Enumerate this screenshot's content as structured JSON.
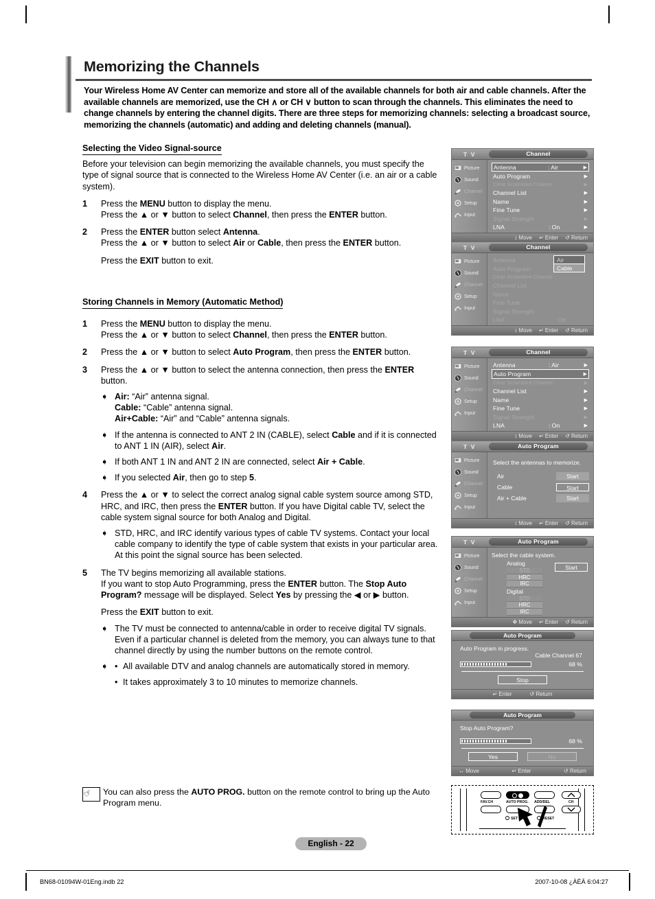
{
  "document": {
    "title": "Memorizing the Channels",
    "intro": "Your Wireless Home AV Center can memorize and store all of the available channels for both air and cable channels. After the available channels are memorized, use the CH ∧ or CH ∨ button to scan through the channels. This eliminates the need to change channels by entering the channel digits. There are three steps for memorizing channels: selecting a broadcast source, memorizing the channels (automatic) and adding and deleting channels (manual).",
    "page_badge": "English - 22",
    "footer_left": "BN68-01094W-01Eng.indb   22",
    "footer_right": "2007-10-08   ¿ÀÈÄ 6:04:27"
  },
  "section1": {
    "heading": "Selecting the Video Signal-source",
    "paragraph": "Before your television can begin memorizing the available channels, you must specify the type of signal source that is connected to the  Wireless Home AV Center (i.e. an air or a cable system).",
    "steps": [
      {
        "num": "1",
        "lines": [
          "Press the <b>MENU</b> button to display the menu.",
          "Press the ▲ or ▼ button to select <b>Channel</b>, then press the <b>ENTER</b> button."
        ]
      },
      {
        "num": "2",
        "lines": [
          "Press the <b>ENTER</b> button select <b>Antenna</b>.",
          "Press the ▲ or ▼ button to select <b>Air</b> or <b>Cable</b>, then press the <b>ENTER</b> button."
        ]
      }
    ],
    "exit_note": "Press the <b>EXIT</b> button to exit."
  },
  "section2": {
    "heading": "Storing Channels in Memory (Automatic Method)",
    "steps": [
      {
        "num": "1",
        "lines": [
          "Press the <b>MENU</b> button to display the menu.",
          "Press the ▲ or ▼ button to select <b>Channel</b>, then press the <b>ENTER</b> button."
        ]
      },
      {
        "num": "2",
        "lines": [
          "Press the ▲ or ▼ button to select <b>Auto Program</b>, then press the <b>ENTER</b> button."
        ]
      },
      {
        "num": "3",
        "lines": [
          "Press the ▲ or ▼ button to select the antenna connection, then press the <b>ENTER</b> button."
        ]
      }
    ],
    "bullets_after_3": [
      "<b>Air:</b> “Air” antenna signal.<br><b>Cable:</b> “Cable” antenna signal.<br><b>Air+Cable:</b> “Air” and “Cable” antenna signals.",
      "If the antenna is connected to ANT 2 IN (CABLE), select <b>Cable</b> and if it is connected to ANT 1 IN (AIR), select <b>Air</b>.",
      "If both ANT 1 IN and ANT 2 IN are connected, select <b>Air + Cable</b>.",
      "If you selected <b>Air</b>, then go to step <b>5</b>."
    ],
    "step4": {
      "num": "4",
      "text": "Press the ▲ or ▼ to select the correct analog signal cable system source among STD, HRC, and IRC, then press the <b>ENTER</b> button. If you have Digital cable TV, select the cable system signal source for both Analog and Digital."
    },
    "bullet_after_4": "STD, HRC, and IRC identify various types of cable TV systems. Contact your local cable company to identify the type of cable system that exists in your particular area. At this point the signal source has been selected.",
    "step5": {
      "num": "5",
      "text": "The TV begins memorizing all available stations.<br>If you want to stop Auto Programming, press the <b>ENTER</b> button. The <b>Stop Auto Program?</b> message will be displayed. Select <b>Yes</b> by pressing the ◀ or ▶ button."
    },
    "exit_note": "Press the <b>EXIT</b> button to exit.",
    "bullets_after_5": [
      "The TV must be connected to antenna/cable in order to receive digital TV signals. Even if a particular channel is deleted from the memory, you can always tune to that channel directly by using the number buttons on the remote control."
    ],
    "dot_bullets": [
      "All available DTV and analog channels are automatically stored in memory.",
      "It takes approximately 3 to 10 minutes to memorize channels."
    ]
  },
  "note": {
    "icon": "hand-pointer-icon",
    "text": "You can also press the <b>AUTO PROG.</b> button on the remote control to bring up the Auto Program menu."
  },
  "osd": {
    "tv_label": "T V",
    "sidebar": [
      {
        "label": "Picture",
        "icon": "picture-icon"
      },
      {
        "label": "Sound",
        "icon": "sound-icon"
      },
      {
        "label": "Channel",
        "icon": "channel-icon"
      },
      {
        "label": "Setup",
        "icon": "setup-icon"
      },
      {
        "label": "Input",
        "icon": "input-icon"
      }
    ],
    "footer": {
      "move": "Move",
      "enter": "Enter",
      "return": "Return"
    },
    "screen1": {
      "title": "Channel",
      "rows": [
        {
          "label": "Antenna",
          "value": ": Air",
          "state": "selected"
        },
        {
          "label": "Auto Program",
          "value": "",
          "state": "normal"
        },
        {
          "label": "Clear Scrambled Channel",
          "value": "",
          "state": "disabled"
        },
        {
          "label": "Channel List",
          "value": "",
          "state": "normal"
        },
        {
          "label": "Name",
          "value": "",
          "state": "normal"
        },
        {
          "label": "Fine Tune",
          "value": "",
          "state": "normal"
        },
        {
          "label": "Signal Strength",
          "value": "",
          "state": "disabled"
        },
        {
          "label": "LNA",
          "value": ": On",
          "state": "normal"
        }
      ]
    },
    "screen2": {
      "title": "Channel",
      "rows": [
        {
          "label": "Antenna",
          "value": ":",
          "state": "dimmed"
        },
        {
          "label": "Auto Program",
          "value": "",
          "state": "dimmed"
        },
        {
          "label": "Clear Scrambled Channel",
          "value": "",
          "state": "disabled"
        },
        {
          "label": "Channel List",
          "value": "",
          "state": "dimmed"
        },
        {
          "label": "Name",
          "value": "",
          "state": "dimmed"
        },
        {
          "label": "Fine Tune",
          "value": "",
          "state": "dimmed"
        },
        {
          "label": "Signal Strength",
          "value": "",
          "state": "disabled"
        },
        {
          "label": "LNA",
          "value": ": On",
          "state": "dimmed"
        }
      ],
      "dropdown": {
        "options": [
          "Air",
          "Cable"
        ],
        "highlighted": "Air"
      }
    },
    "screen3": {
      "title": "Channel",
      "rows": [
        {
          "label": "Antenna",
          "value": ": Air",
          "state": "normal"
        },
        {
          "label": "Auto Program",
          "value": "",
          "state": "selected"
        },
        {
          "label": "Clear Scrambled Channel",
          "value": "",
          "state": "disabled"
        },
        {
          "label": "Channel List",
          "value": "",
          "state": "normal"
        },
        {
          "label": "Name",
          "value": "",
          "state": "normal"
        },
        {
          "label": "Fine Tune",
          "value": "",
          "state": "normal"
        },
        {
          "label": "Signal Strength",
          "value": "",
          "state": "disabled"
        },
        {
          "label": "LNA",
          "value": ": On",
          "state": "normal"
        }
      ]
    },
    "screen4": {
      "title": "Auto Program",
      "prompt": "Select the antennas to memorize.",
      "options": [
        {
          "name": "Air",
          "button": "Start",
          "selected": false
        },
        {
          "name": "Cable",
          "button": "Start",
          "selected": true
        },
        {
          "name": "Air + Cable",
          "button": "Start",
          "selected": false
        }
      ]
    },
    "screen5": {
      "title": "Auto Program",
      "prompt": "Select the cable system.",
      "analog_label": "Analog",
      "analog_options": [
        "STD",
        "HRC",
        "IRC"
      ],
      "digital_label": "Digital",
      "digital_options": [
        "STD",
        "HRC",
        "IRC"
      ],
      "start_button": "Start"
    },
    "screen6": {
      "title": "Auto Program",
      "line1": "Auto Program in progress.",
      "line2": "Cable Channel 67",
      "percent": "68 %",
      "progress": 68,
      "button": "Stop",
      "footer": {
        "enter": "Enter",
        "return": "Return"
      }
    },
    "screen7": {
      "title": "Auto Program",
      "line1": "Stop Auto Program?",
      "percent": "68 %",
      "progress": 68,
      "yes": "Yes",
      "no": "No",
      "footer": {
        "move": "Move",
        "enter": "Enter",
        "return": "Return"
      }
    }
  },
  "remote": {
    "buttons": [
      {
        "label": "FAV.CH"
      },
      {
        "label": "AUTO PROG."
      },
      {
        "label": "ADD/DEL"
      },
      {
        "label": "CH"
      },
      {
        "label": "SET"
      },
      {
        "label": "RESET"
      }
    ]
  }
}
